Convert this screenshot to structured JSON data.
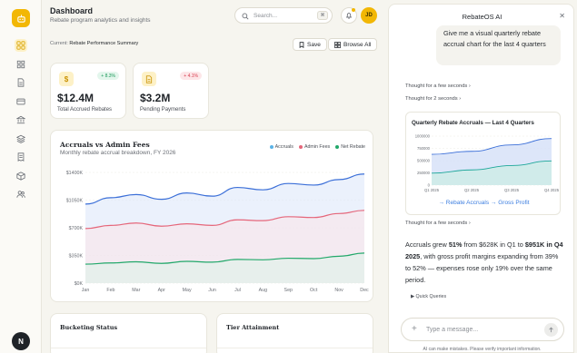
{
  "header": {
    "title": "Dashboard",
    "subtitle": "Rebate program analytics and insights",
    "search_placeholder": "Search...",
    "shortcut": "⌘",
    "user_initials": "JD"
  },
  "rail": {
    "logo_icon": "robot-icon",
    "items": [
      "grid-icon",
      "apps-icon",
      "document-icon",
      "card-icon",
      "bank-icon",
      "layers-icon",
      "receipt-icon",
      "box-icon",
      "users-icon"
    ],
    "active_index": 0,
    "user_letter": "N"
  },
  "breadcrumb": {
    "prefix": "Current:",
    "current": "Rebate Performance Summary"
  },
  "actions": {
    "save": "Save",
    "browse": "Browse All"
  },
  "kpis": [
    {
      "icon": "$",
      "change": "+ 8.3%",
      "value": "$12.4M",
      "label": "Total Accrued Rebates",
      "trend": "up"
    },
    {
      "icon": "doc",
      "change": "+ 4.1%",
      "value": "$3.2M",
      "label": "Pending Payments",
      "trend": "down"
    }
  ],
  "colors": {
    "accent": "#f2b705",
    "accruals": "#3b6fd8",
    "admin_fees": "#e5667a",
    "net_rebate": "#22a86a",
    "positive_bg": "#e3f6ec",
    "positive_fg": "#1e9a5c",
    "negative_bg": "#fde6e8",
    "negative_fg": "#d63a4c"
  },
  "chart_data": [
    {
      "type": "area",
      "title": "Accruals vs Admin Fees",
      "subtitle": "Monthly rebate accrual breakdown, FY 2026",
      "categories": [
        "Jan",
        "Feb",
        "Mar",
        "Apr",
        "May",
        "Jun",
        "Jul",
        "Aug",
        "Sep",
        "Oct",
        "Nov",
        "Dec"
      ],
      "yticks": [
        "$0K",
        "$350K",
        "$700K",
        "$1050K",
        "$1400K"
      ],
      "ylim": [
        0,
        1400
      ],
      "legend_position": "top-right",
      "grid": true,
      "series": [
        {
          "name": "Accruals",
          "values": [
            1000,
            1080,
            1120,
            1060,
            1140,
            1100,
            1210,
            1180,
            1260,
            1240,
            1310,
            1380
          ]
        },
        {
          "name": "Admin Fees",
          "values": [
            690,
            730,
            760,
            720,
            750,
            730,
            800,
            790,
            840,
            830,
            880,
            920
          ]
        },
        {
          "name": "Net Rebate",
          "values": [
            240,
            255,
            270,
            250,
            275,
            265,
            300,
            295,
            315,
            310,
            340,
            380
          ]
        }
      ]
    },
    {
      "type": "area",
      "title": "Quarterly Rebate Accruals — Last 4 Quarters",
      "categories": [
        "Q1 2025",
        "Q2 2025",
        "Q3 2025",
        "Q4 2025"
      ],
      "yticks": [
        "0",
        "250000",
        "500000",
        "750000",
        "1000000"
      ],
      "ylim": [
        0,
        1000000
      ],
      "series": [
        {
          "name": "Rebate Accruals",
          "values": [
            628000,
            690000,
            820000,
            951000
          ]
        },
        {
          "name": "Gross Profit",
          "values": [
            245000,
            310000,
            400000,
            495000
          ]
        }
      ]
    }
  ],
  "bottom_cards": {
    "left_title": "Bucketing Status",
    "right_title": "Tier Attainment"
  },
  "assistant": {
    "title": "RebateOS AI",
    "user_message": "Give me a visual quarterly rebate accrual chart for the last 4 quarters",
    "thought_1": "Thought for a few seconds ›",
    "thought_2": "Thought for 2 seconds ›",
    "thought_3": "Thought for a few seconds ›",
    "legend_text": "→ Rebate Accruals → Gross Profit",
    "answer_a": "Accruals grew ",
    "answer_b": "51%",
    "answer_c": " from $628K in Q1 to ",
    "answer_d": "$951K in Q4 2025",
    "answer_e": ", with gross profit margins expanding from 39% to 52% — expenses rose only 19% over the same period.",
    "quick_queries": "▶ Quick Queries",
    "input_placeholder": "Type a message...",
    "disclaimer": "AI can make mistakes. Please verify important information."
  }
}
